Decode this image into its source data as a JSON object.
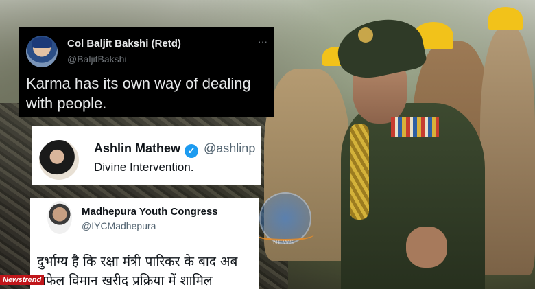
{
  "tweets": [
    {
      "name": "Col Baljit Bakshi (Retd)",
      "handle": "@BaljitBakshi",
      "more_icon": "more-options-icon",
      "text": "Karma has its own way of dealing with people."
    },
    {
      "name": "Ashlin Mathew",
      "handle": "@ashlinp",
      "verified_icon": "verified-check-icon",
      "text": "Divine Intervention."
    },
    {
      "name": "Madhepura Youth Congress",
      "handle": "@IYCMadhepura",
      "text": "दुर्भाग्य है कि रक्षा मंत्री पारिकर के बाद अब राफेल विमान खरीद प्रक्रिया में शामिल"
    }
  ],
  "watermark": {
    "text": "NEWS"
  },
  "brand": {
    "label": "Newstrend"
  },
  "colors": {
    "dark_card": "#000000",
    "light_card": "#ffffff",
    "verified": "#1d9bf0",
    "brand_red": "#c0161a"
  }
}
